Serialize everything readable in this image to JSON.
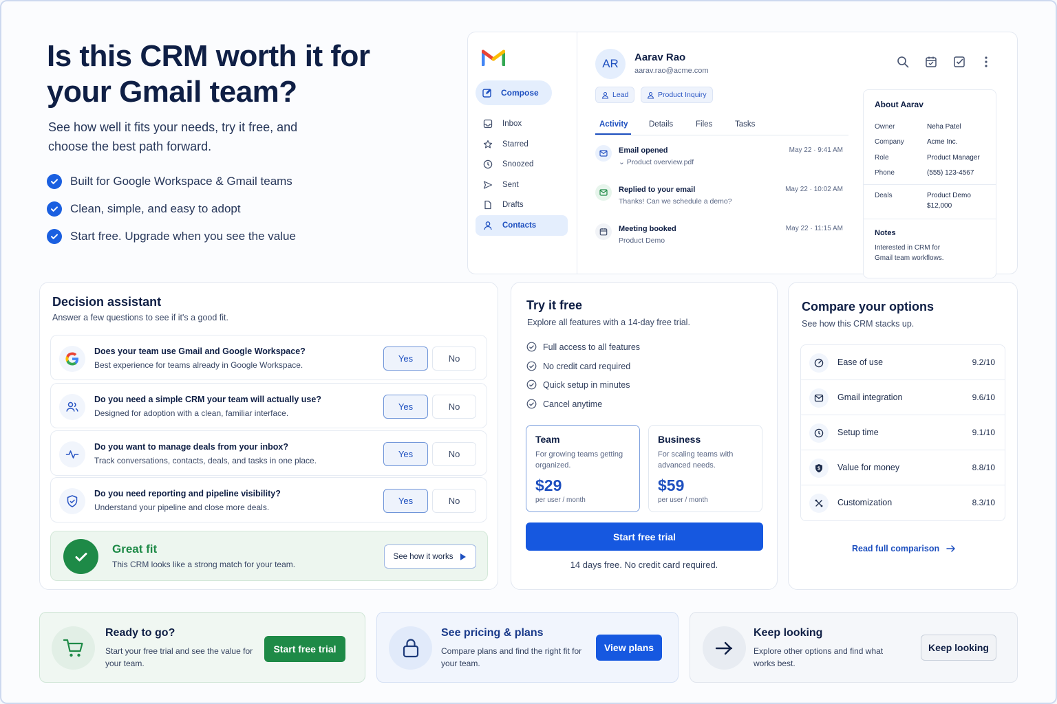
{
  "hero": {
    "title": "Is this CRM worth it for your Gmail team?",
    "subtitle": "See how well it fits your needs, try it free, and choose the best path forward.",
    "checks": [
      "Built for Google Workspace & Gmail teams",
      "Clean, simple, and easy to adopt",
      "Start free. Upgrade when you see the value"
    ]
  },
  "gmail": {
    "compose": "Compose",
    "nav": [
      "Inbox",
      "Starred",
      "Snoozed",
      "Sent",
      "Drafts",
      "Contacts"
    ],
    "active_nav": "Contacts",
    "contact": {
      "initials": "AR",
      "name": "Aarav Rao",
      "email": "aarav.rao@acme.com",
      "tags": [
        "Lead",
        "Product Inquiry"
      ]
    },
    "tabs": [
      "Activity",
      "Details",
      "Files",
      "Tasks"
    ],
    "active_tab": "Activity",
    "activity": [
      {
        "title": "Email opened",
        "sub": "Product overview.pdf",
        "date": "May 22 · 9:41 AM",
        "icon": "mail-icon"
      },
      {
        "title": "Replied to your email",
        "sub": "Thanks! Can we schedule a demo?",
        "date": "May 22 · 10:02 AM",
        "icon": "reply-icon"
      },
      {
        "title": "Meeting booked",
        "sub": "Product Demo",
        "date": "May 22 · 11:15 AM",
        "icon": "calendar-icon"
      }
    ],
    "about": {
      "title": "About Aarav",
      "fields": [
        {
          "k": "Owner",
          "v": "Neha Patel"
        },
        {
          "k": "Company",
          "v": "Acme Inc."
        },
        {
          "k": "Role",
          "v": "Product Manager"
        },
        {
          "k": "Phone",
          "v": "(555) 123-4567"
        }
      ],
      "deals_label": "Deals",
      "deal_name": "Product Demo",
      "deal_value": "$12,000",
      "notes_label": "Notes",
      "notes": "Interested in CRM for Gmail team workflows."
    }
  },
  "decision": {
    "title": "Decision assistant",
    "subtitle": "Answer a few questions to see if it's a good fit.",
    "yes": "Yes",
    "no": "No",
    "questions": [
      {
        "q": "Does your team use Gmail and Google Workspace?",
        "sub": "Best experience for teams already in Google Workspace.",
        "answer": "Yes"
      },
      {
        "q": "Do you need a simple CRM your team will actually use?",
        "sub": "Designed for adoption with a clean, familiar interface.",
        "answer": "Yes"
      },
      {
        "q": "Do you want to manage deals from your inbox?",
        "sub": "Track conversations, contacts, deals, and tasks in one place.",
        "answer": "Yes"
      },
      {
        "q": "Do you need reporting and pipeline visibility?",
        "sub": "Understand your pipeline and close more deals.",
        "answer": "Yes"
      }
    ],
    "result_title": "Great fit",
    "result_sub": "This CRM looks like a strong match for your team.",
    "result_button": "See how it works"
  },
  "trial": {
    "title": "Try it free",
    "subtitle": "Explore all features with a 14-day free trial.",
    "features": [
      "Full access to all features",
      "No credit card required",
      "Quick setup in minutes",
      "Cancel anytime"
    ],
    "plans": [
      {
        "name": "Team",
        "desc": "For growing teams getting organized.",
        "price": "$29",
        "unit": "per user / month",
        "selected": true
      },
      {
        "name": "Business",
        "desc": "For scaling teams with advanced needs.",
        "price": "$59",
        "unit": "per user / month",
        "selected": false
      }
    ],
    "cta": "Start free trial",
    "note": "14 days free. No credit card required."
  },
  "compare": {
    "title": "Compare your options",
    "subtitle": "See how this CRM stacks up.",
    "rows": [
      {
        "label": "Ease of use",
        "score": "9.2/10",
        "icon": "gauge-icon"
      },
      {
        "label": "Gmail integration",
        "score": "9.6/10",
        "icon": "mail-icon"
      },
      {
        "label": "Setup time",
        "score": "9.1/10",
        "icon": "clock-icon"
      },
      {
        "label": "Value for money",
        "score": "8.8/10",
        "icon": "shield-dollar-icon"
      },
      {
        "label": "Customization",
        "score": "8.3/10",
        "icon": "sliders-icon"
      }
    ],
    "link": "Read full comparison"
  },
  "bottom": [
    {
      "title": "Ready to go?",
      "sub": "Start your free trial and see the value for your team.",
      "button": "Start free trial"
    },
    {
      "title": "See pricing & plans",
      "sub": "Compare plans and find the right fit for your team.",
      "button": "View plans"
    },
    {
      "title": "Keep looking",
      "sub": "Explore other options and find what works best.",
      "button": "Keep looking"
    }
  ],
  "colors": {
    "primary": "#1658e0",
    "success": "#1e8a47",
    "navy": "#0f1f45"
  }
}
